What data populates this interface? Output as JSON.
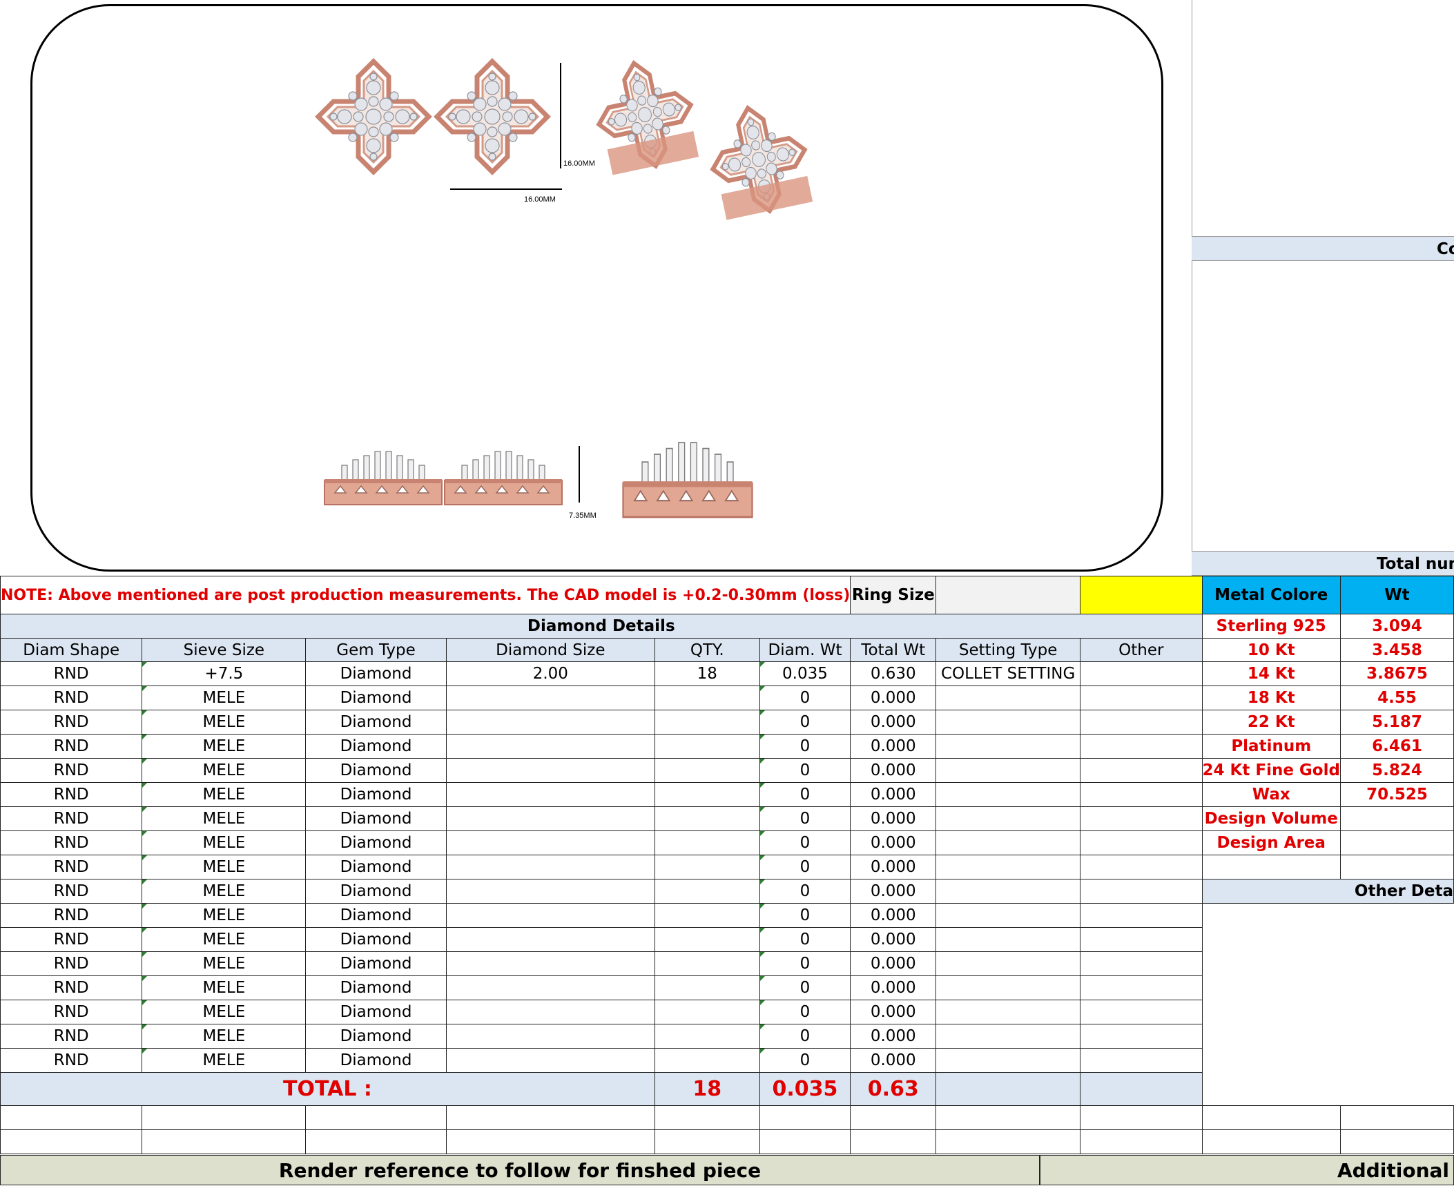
{
  "image_dims": {
    "top_height": "16.00MM",
    "top_width": "16.00MM",
    "side_height": "7.35MM"
  },
  "note": "NOTE: Above mentioned are post production measurements. The CAD model is +0.2-0.30mm (loss)",
  "ring_size_label": "Ring Size",
  "ring_size_value": "",
  "diamond_title": "Diamond Details",
  "headers": [
    "Diam Shape",
    "Sieve Size",
    "Gem Type",
    "Diamond Size",
    "QTY.",
    "Diam. Wt",
    "Total Wt",
    "Setting Type",
    "Other"
  ],
  "rows": [
    [
      "RND",
      "+7.5",
      "Diamond",
      "2.00",
      "18",
      "0.035",
      "0.630",
      "COLLET SETTING",
      ""
    ],
    [
      "RND",
      "MELE",
      "Diamond",
      "",
      "",
      "0",
      "0.000",
      "",
      ""
    ],
    [
      "RND",
      "MELE",
      "Diamond",
      "",
      "",
      "0",
      "0.000",
      "",
      ""
    ],
    [
      "RND",
      "MELE",
      "Diamond",
      "",
      "",
      "0",
      "0.000",
      "",
      ""
    ],
    [
      "RND",
      "MELE",
      "Diamond",
      "",
      "",
      "0",
      "0.000",
      "",
      ""
    ],
    [
      "RND",
      "MELE",
      "Diamond",
      "",
      "",
      "0",
      "0.000",
      "",
      ""
    ],
    [
      "RND",
      "MELE",
      "Diamond",
      "",
      "",
      "0",
      "0.000",
      "",
      ""
    ],
    [
      "RND",
      "MELE",
      "Diamond",
      "",
      "",
      "0",
      "0.000",
      "",
      ""
    ],
    [
      "RND",
      "MELE",
      "Diamond",
      "",
      "",
      "0",
      "0.000",
      "",
      ""
    ],
    [
      "RND",
      "MELE",
      "Diamond",
      "",
      "",
      "0",
      "0.000",
      "",
      ""
    ],
    [
      "RND",
      "MELE",
      "Diamond",
      "",
      "",
      "0",
      "0.000",
      "",
      ""
    ],
    [
      "RND",
      "MELE",
      "Diamond",
      "",
      "",
      "0",
      "0.000",
      "",
      ""
    ],
    [
      "RND",
      "MELE",
      "Diamond",
      "",
      "",
      "0",
      "0.000",
      "",
      ""
    ],
    [
      "RND",
      "MELE",
      "Diamond",
      "",
      "",
      "0",
      "0.000",
      "",
      ""
    ],
    [
      "RND",
      "MELE",
      "Diamond",
      "",
      "",
      "0",
      "0.000",
      "",
      ""
    ],
    [
      "RND",
      "MELE",
      "Diamond",
      "",
      "",
      "0",
      "0.000",
      "",
      ""
    ],
    [
      "RND",
      "MELE",
      "Diamond",
      "",
      "",
      "0",
      "0.000",
      "",
      ""
    ]
  ],
  "total": {
    "label": "TOTAL :",
    "qty": "18",
    "diam_wt": "0.035",
    "total_wt": "0.63"
  },
  "metal": {
    "header_label": "Metal Colore",
    "header_wt": "Wt",
    "rows": [
      [
        "Sterling 925",
        "3.094"
      ],
      [
        "10 Kt",
        "3.458"
      ],
      [
        "14 Kt",
        "3.8675"
      ],
      [
        "18 Kt",
        "4.55"
      ],
      [
        "22 Kt",
        "5.187"
      ],
      [
        "Platinum",
        "6.461"
      ],
      [
        "24 Kt Fine Gold",
        "5.824"
      ],
      [
        "Wax",
        "70.525"
      ],
      [
        "Design Volume",
        ""
      ],
      [
        "Design Area",
        ""
      ]
    ]
  },
  "right_panel": {
    "top_bar": "Co",
    "mid_bar": "Total num",
    "other_details": "Other Deta",
    "footer_right": "Additional St"
  },
  "footer_left": "Render reference to follow for finshed piece",
  "colors": {
    "rose_gold": "#d9a08c",
    "header_blue": "#dce6f2",
    "metal_header": "#00b0f0",
    "highlight": "#ffff00",
    "red_text": "#e00000",
    "footer_bg": "#dde0cc"
  }
}
